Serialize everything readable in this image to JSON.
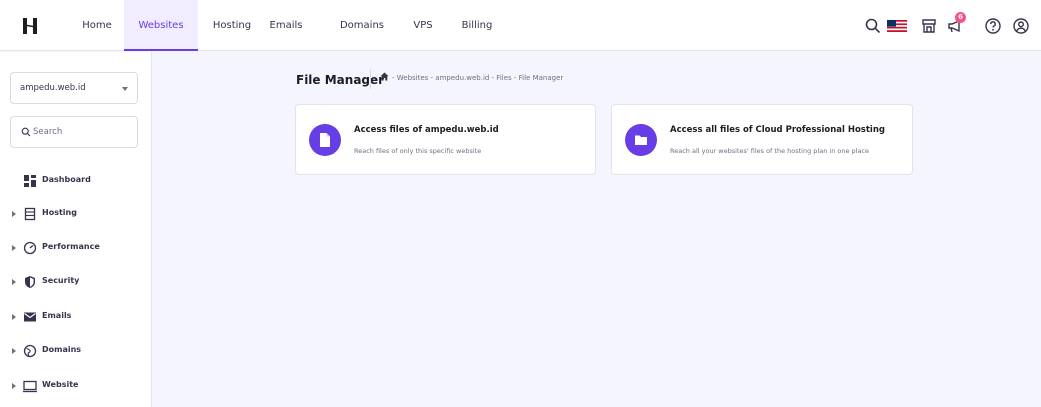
{
  "nav": {
    "items": [
      {
        "label": "Home",
        "active": false
      },
      {
        "label": "Websites",
        "active": true
      },
      {
        "label": "Hosting",
        "active": false
      },
      {
        "label": "Emails",
        "active": false
      },
      {
        "label": "Domains",
        "active": false
      },
      {
        "label": "VPS",
        "active": false
      },
      {
        "label": "Billing",
        "active": false
      }
    ],
    "notification_count": "6"
  },
  "sidebar": {
    "site_select_value": "ampedu.web.id",
    "search_placeholder": "Search",
    "items": [
      {
        "label": "Dashboard",
        "icon": "dashboard-icon",
        "expandable": false
      },
      {
        "label": "Hosting",
        "icon": "hosting-icon",
        "expandable": true
      },
      {
        "label": "Performance",
        "icon": "performance-icon",
        "expandable": true
      },
      {
        "label": "Security",
        "icon": "security-icon",
        "expandable": true
      },
      {
        "label": "Emails",
        "icon": "email-icon",
        "expandable": true
      },
      {
        "label": "Domains",
        "icon": "domains-icon",
        "expandable": true
      },
      {
        "label": "Website",
        "icon": "website-icon",
        "expandable": true
      }
    ]
  },
  "main": {
    "page_title": "File Manager",
    "breadcrumb": "- Websites - ampedu.web.id - Files - File Manager",
    "cards": [
      {
        "title": "Access files of ampedu.web.id",
        "description": "Reach files of only this specific website",
        "icon": "file-icon"
      },
      {
        "title": "Access all files of Cloud Professional Hosting",
        "description": "Reach all your websites' files of the hosting plan in one place",
        "icon": "folder-icon"
      }
    ]
  },
  "colors": {
    "accent": "#673de6",
    "background": "#f4f5ff",
    "badge": "#fc5185"
  }
}
